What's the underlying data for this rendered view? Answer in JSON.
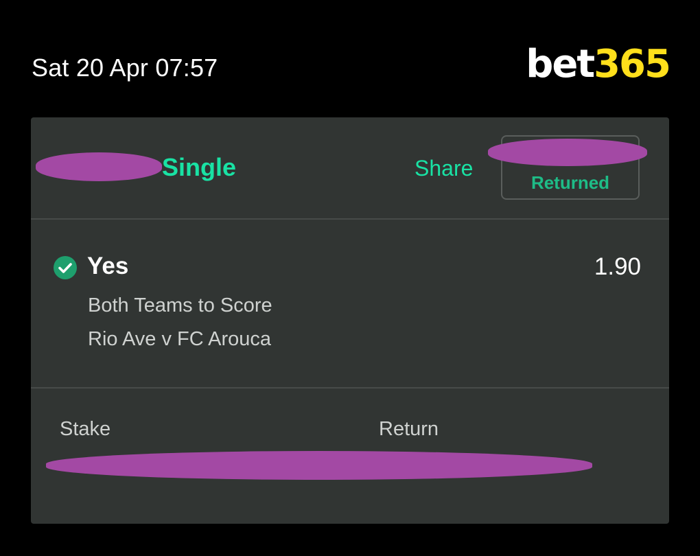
{
  "status_bar": {
    "datetime": "Sat 20 Apr 07:57"
  },
  "brand": {
    "part1": "bet",
    "part2": "365",
    "colors": {
      "white": "#ffffff",
      "yellow": "#ffdf1b"
    }
  },
  "bet_slip": {
    "bet_type": "Single",
    "share_label": "Share",
    "status": "Returned",
    "selection": {
      "name": "Yes",
      "odds": "1.90",
      "market": "Both Teams to Score",
      "event": "Rio Ave v FC Arouca",
      "icon": "check-circle-icon"
    },
    "footer": {
      "stake_label": "Stake",
      "return_label": "Return"
    },
    "colors": {
      "accent_green": "#19e2a4",
      "status_green": "#1ebc87",
      "card_bg": "#313533",
      "redaction": "#a349a4"
    }
  }
}
